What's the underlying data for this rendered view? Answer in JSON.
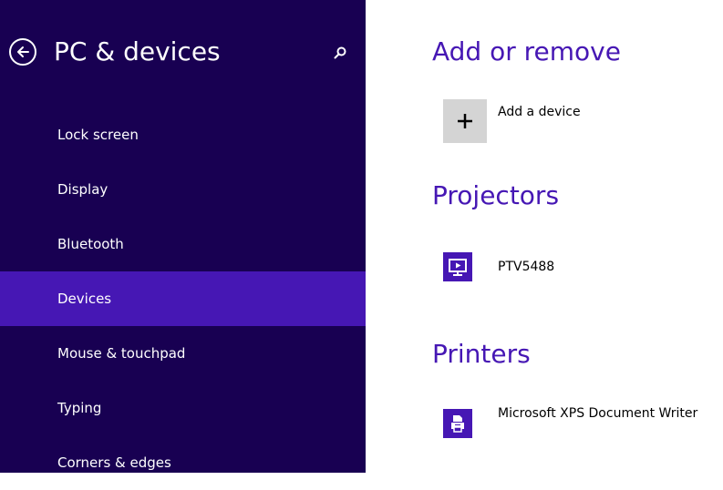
{
  "sidebar": {
    "title": "PC & devices",
    "items": [
      {
        "label": "Lock screen"
      },
      {
        "label": "Display"
      },
      {
        "label": "Bluetooth"
      },
      {
        "label": "Devices"
      },
      {
        "label": "Mouse & touchpad"
      },
      {
        "label": "Typing"
      },
      {
        "label": "Corners & edges"
      }
    ],
    "selected": "Devices"
  },
  "main": {
    "add_section": {
      "title": "Add or remove",
      "add_label": "Add a device"
    },
    "projectors": {
      "title": "Projectors",
      "devices": [
        {
          "name": "PTV5488",
          "icon": "monitor-play-icon"
        }
      ]
    },
    "printers": {
      "title": "Printers",
      "devices": [
        {
          "name": "Microsoft XPS Document Writer",
          "icon": "printer-icon"
        }
      ]
    }
  },
  "colors": {
    "sidebar_bg": "#180052",
    "accent": "#4617b4",
    "tile_gray": "#d4d4d4"
  }
}
